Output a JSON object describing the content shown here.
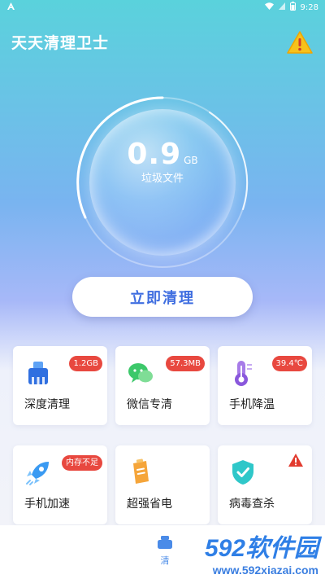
{
  "status_bar": {
    "left_icon": "a-icon",
    "time": "9:28"
  },
  "header": {
    "title": "天天清理卫士",
    "alert_icon": "warning-icon"
  },
  "junk": {
    "value": "0.9",
    "unit": "GB",
    "label": "垃圾文件"
  },
  "clean_button": {
    "label": "立即清理",
    "color": "#3f6ee0"
  },
  "features": [
    {
      "label": "深度清理",
      "badge": "1.2GB",
      "icon": "broom-icon"
    },
    {
      "label": "微信专清",
      "badge": "57.3MB",
      "icon": "wechat-icon"
    },
    {
      "label": "手机降温",
      "badge": "39.4℃",
      "icon": "thermometer-icon"
    },
    {
      "label": "手机加速",
      "badge": "内存不足",
      "icon": "rocket-icon"
    },
    {
      "label": "超强省电",
      "badge": "",
      "icon": "battery-icon"
    },
    {
      "label": "病毒查杀",
      "badge": "",
      "icon": "shield-icon"
    }
  ],
  "bottom_nav": {
    "active_label": "清"
  },
  "watermark": {
    "brand": "592软件园",
    "url": "www.592xiazai.com"
  },
  "colors": {
    "badge": "#e8483f",
    "accent": "#3f6ee0"
  }
}
